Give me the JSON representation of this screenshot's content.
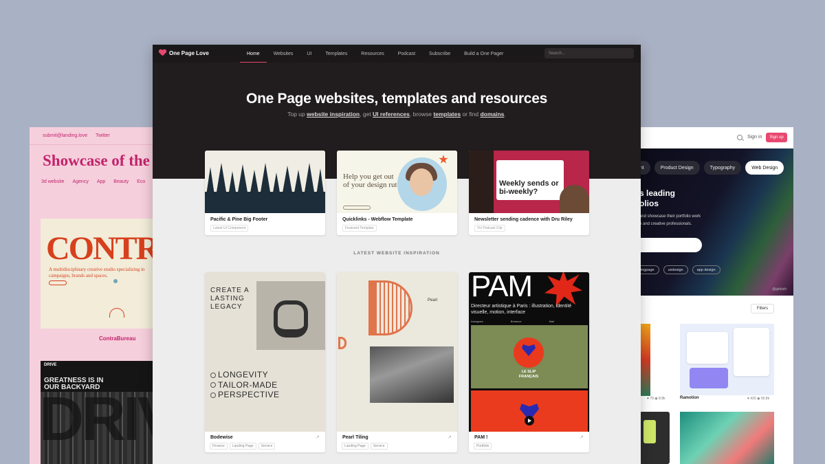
{
  "left_window": {
    "top_links": [
      "submit@landing.love",
      "Twitter"
    ],
    "title": "Showcase of the",
    "nav": [
      "3d website",
      "Agency",
      "App",
      "Beauty",
      "Eco"
    ],
    "card1": {
      "word": "CONTR",
      "tagline": "A multidisciplinary creative studio specializing in campaigns, brands and spaces.",
      "label": "ContraBureau"
    },
    "card2": {
      "logo": "DRIVE",
      "headline": "GREATNESS IS IN OUR BACKYARD",
      "big": "DRIV"
    }
  },
  "main": {
    "logo": "One Page Love",
    "menu": [
      "Home",
      "Websites",
      "UI",
      "Templates",
      "Resources",
      "Podcast",
      "Subscribe",
      "Build a One Pager"
    ],
    "active_menu": "Home",
    "search_placeholder": "Search...",
    "hero_title": "One Page websites, templates and resources",
    "hero_sub": {
      "t1": "Top up ",
      "l1": "website inspiration",
      "t2": ", get ",
      "l2": "UI references",
      "t3": ", browse ",
      "l3": "templates",
      "t4": " or find ",
      "l4": "domains",
      "t5": "."
    },
    "featured": [
      {
        "title": "Pacific & Pine Big Footer",
        "tag": "Latest UI Component"
      },
      {
        "title": "Quicklinks - Webflow Template",
        "tag": "Featured Template",
        "thumb_text": "Help you get out of your design rut"
      },
      {
        "title": "Newsletter sending cadence with Dru Riley",
        "tag": "Yo! Podcast Clip",
        "thumb_text": "Weekly sends or bi-weekly?"
      }
    ],
    "section_label": "LATEST WEBSITE INSPIRATION",
    "inspiration": [
      {
        "title": "Bodewise",
        "tags": [
          "Finance",
          "Landing Page",
          "Service"
        ],
        "thumb_top": "CREATE A LASTING LEGACY",
        "thumb_list": [
          "LONGEVITY",
          "TAILOR-MADE",
          "PERSPECTIVE"
        ]
      },
      {
        "title": "Pearl Tiling",
        "tags": [
          "Landing Page",
          "Service"
        ],
        "thumb_name": "Pearl"
      },
      {
        "title": "PAM !",
        "tags": [
          "Portfolio"
        ],
        "thumb_title": "PAM",
        "thumb_desc": "Directeur artistique à Paris : illustration, identité visuelle, motion, interface",
        "thumb_cols": [
          "Instagram",
          "Behance",
          "Mail"
        ],
        "thumb_slip": "LE SLIP FRANÇAIS"
      }
    ]
  },
  "right_window": {
    "sign_in": "Sign in",
    "sign_up": "Sign up",
    "chips": [
      "rint",
      "Product Design",
      "Typography",
      "Web Design"
    ],
    "active_chip": "Web Design",
    "hero_title": "s leading\nolios",
    "hero_text": "and showcase their portfolio work\nn and creative professionals.",
    "tags": [
      "ingpage",
      "uxdesign",
      "app design"
    ],
    "credit": "@glebich",
    "filters": "Filters",
    "shot_meta_left": "♥ 79  ◉ 8.8k",
    "shot_author": "Ramotion",
    "shot_meta_right": "♥ 420  ◉ 56.8k"
  }
}
